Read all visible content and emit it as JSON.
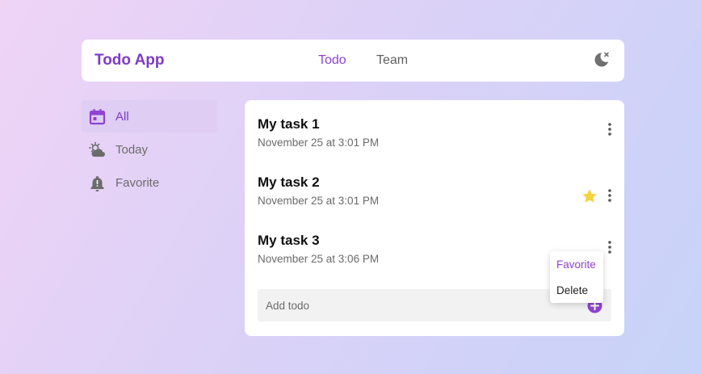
{
  "header": {
    "brand": "Todo App",
    "nav": [
      {
        "label": "Todo",
        "active": true
      },
      {
        "label": "Team",
        "active": false
      }
    ],
    "theme_toggle_icon": "moon-icon"
  },
  "sidebar": {
    "items": [
      {
        "label": "All",
        "icon": "calendar-icon",
        "active": true
      },
      {
        "label": "Today",
        "icon": "partly-cloudy-icon",
        "active": false
      },
      {
        "label": "Favorite",
        "icon": "bell-alert-icon",
        "active": false
      }
    ]
  },
  "tasks": [
    {
      "title": "My task 1",
      "date": "November 25 at 3:01 PM",
      "favorite": false
    },
    {
      "title": "My task 2",
      "date": "November 25 at 3:01 PM",
      "favorite": true
    },
    {
      "title": "My task 3",
      "date": "November 25 at 3:06 PM",
      "favorite": false
    }
  ],
  "add_todo": {
    "placeholder": "Add todo"
  },
  "context_menu": {
    "favorite_label": "Favorite",
    "delete_label": "Delete"
  },
  "colors": {
    "accent": "#8e44cf",
    "star": "#f7d23e",
    "active_bg": "#dfcdf4"
  }
}
